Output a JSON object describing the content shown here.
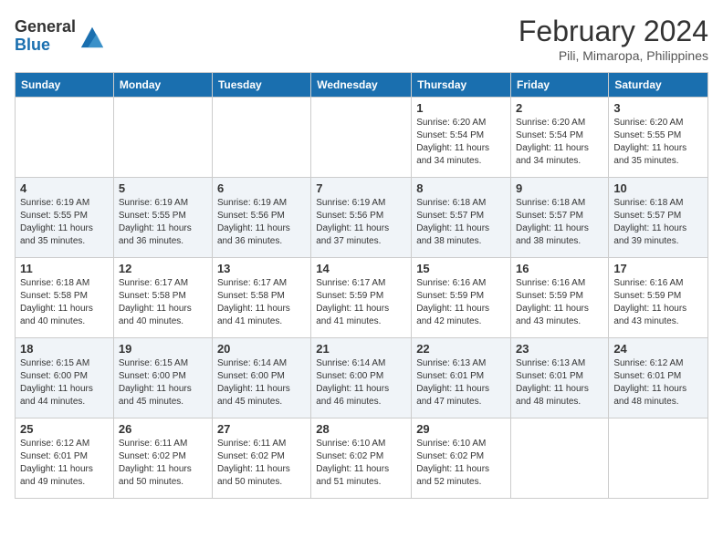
{
  "logo": {
    "general": "General",
    "blue": "Blue"
  },
  "title": "February 2024",
  "location": "Pili, Mimaropa, Philippines",
  "days_of_week": [
    "Sunday",
    "Monday",
    "Tuesday",
    "Wednesday",
    "Thursday",
    "Friday",
    "Saturday"
  ],
  "weeks": [
    [
      {
        "day": "",
        "sunrise": "",
        "sunset": "",
        "daylight": ""
      },
      {
        "day": "",
        "sunrise": "",
        "sunset": "",
        "daylight": ""
      },
      {
        "day": "",
        "sunrise": "",
        "sunset": "",
        "daylight": ""
      },
      {
        "day": "",
        "sunrise": "",
        "sunset": "",
        "daylight": ""
      },
      {
        "day": "1",
        "sunrise": "Sunrise: 6:20 AM",
        "sunset": "Sunset: 5:54 PM",
        "daylight": "Daylight: 11 hours and 34 minutes."
      },
      {
        "day": "2",
        "sunrise": "Sunrise: 6:20 AM",
        "sunset": "Sunset: 5:54 PM",
        "daylight": "Daylight: 11 hours and 34 minutes."
      },
      {
        "day": "3",
        "sunrise": "Sunrise: 6:20 AM",
        "sunset": "Sunset: 5:55 PM",
        "daylight": "Daylight: 11 hours and 35 minutes."
      }
    ],
    [
      {
        "day": "4",
        "sunrise": "Sunrise: 6:19 AM",
        "sunset": "Sunset: 5:55 PM",
        "daylight": "Daylight: 11 hours and 35 minutes."
      },
      {
        "day": "5",
        "sunrise": "Sunrise: 6:19 AM",
        "sunset": "Sunset: 5:55 PM",
        "daylight": "Daylight: 11 hours and 36 minutes."
      },
      {
        "day": "6",
        "sunrise": "Sunrise: 6:19 AM",
        "sunset": "Sunset: 5:56 PM",
        "daylight": "Daylight: 11 hours and 36 minutes."
      },
      {
        "day": "7",
        "sunrise": "Sunrise: 6:19 AM",
        "sunset": "Sunset: 5:56 PM",
        "daylight": "Daylight: 11 hours and 37 minutes."
      },
      {
        "day": "8",
        "sunrise": "Sunrise: 6:18 AM",
        "sunset": "Sunset: 5:57 PM",
        "daylight": "Daylight: 11 hours and 38 minutes."
      },
      {
        "day": "9",
        "sunrise": "Sunrise: 6:18 AM",
        "sunset": "Sunset: 5:57 PM",
        "daylight": "Daylight: 11 hours and 38 minutes."
      },
      {
        "day": "10",
        "sunrise": "Sunrise: 6:18 AM",
        "sunset": "Sunset: 5:57 PM",
        "daylight": "Daylight: 11 hours and 39 minutes."
      }
    ],
    [
      {
        "day": "11",
        "sunrise": "Sunrise: 6:18 AM",
        "sunset": "Sunset: 5:58 PM",
        "daylight": "Daylight: 11 hours and 40 minutes."
      },
      {
        "day": "12",
        "sunrise": "Sunrise: 6:17 AM",
        "sunset": "Sunset: 5:58 PM",
        "daylight": "Daylight: 11 hours and 40 minutes."
      },
      {
        "day": "13",
        "sunrise": "Sunrise: 6:17 AM",
        "sunset": "Sunset: 5:58 PM",
        "daylight": "Daylight: 11 hours and 41 minutes."
      },
      {
        "day": "14",
        "sunrise": "Sunrise: 6:17 AM",
        "sunset": "Sunset: 5:59 PM",
        "daylight": "Daylight: 11 hours and 41 minutes."
      },
      {
        "day": "15",
        "sunrise": "Sunrise: 6:16 AM",
        "sunset": "Sunset: 5:59 PM",
        "daylight": "Daylight: 11 hours and 42 minutes."
      },
      {
        "day": "16",
        "sunrise": "Sunrise: 6:16 AM",
        "sunset": "Sunset: 5:59 PM",
        "daylight": "Daylight: 11 hours and 43 minutes."
      },
      {
        "day": "17",
        "sunrise": "Sunrise: 6:16 AM",
        "sunset": "Sunset: 5:59 PM",
        "daylight": "Daylight: 11 hours and 43 minutes."
      }
    ],
    [
      {
        "day": "18",
        "sunrise": "Sunrise: 6:15 AM",
        "sunset": "Sunset: 6:00 PM",
        "daylight": "Daylight: 11 hours and 44 minutes."
      },
      {
        "day": "19",
        "sunrise": "Sunrise: 6:15 AM",
        "sunset": "Sunset: 6:00 PM",
        "daylight": "Daylight: 11 hours and 45 minutes."
      },
      {
        "day": "20",
        "sunrise": "Sunrise: 6:14 AM",
        "sunset": "Sunset: 6:00 PM",
        "daylight": "Daylight: 11 hours and 45 minutes."
      },
      {
        "day": "21",
        "sunrise": "Sunrise: 6:14 AM",
        "sunset": "Sunset: 6:00 PM",
        "daylight": "Daylight: 11 hours and 46 minutes."
      },
      {
        "day": "22",
        "sunrise": "Sunrise: 6:13 AM",
        "sunset": "Sunset: 6:01 PM",
        "daylight": "Daylight: 11 hours and 47 minutes."
      },
      {
        "day": "23",
        "sunrise": "Sunrise: 6:13 AM",
        "sunset": "Sunset: 6:01 PM",
        "daylight": "Daylight: 11 hours and 48 minutes."
      },
      {
        "day": "24",
        "sunrise": "Sunrise: 6:12 AM",
        "sunset": "Sunset: 6:01 PM",
        "daylight": "Daylight: 11 hours and 48 minutes."
      }
    ],
    [
      {
        "day": "25",
        "sunrise": "Sunrise: 6:12 AM",
        "sunset": "Sunset: 6:01 PM",
        "daylight": "Daylight: 11 hours and 49 minutes."
      },
      {
        "day": "26",
        "sunrise": "Sunrise: 6:11 AM",
        "sunset": "Sunset: 6:02 PM",
        "daylight": "Daylight: 11 hours and 50 minutes."
      },
      {
        "day": "27",
        "sunrise": "Sunrise: 6:11 AM",
        "sunset": "Sunset: 6:02 PM",
        "daylight": "Daylight: 11 hours and 50 minutes."
      },
      {
        "day": "28",
        "sunrise": "Sunrise: 6:10 AM",
        "sunset": "Sunset: 6:02 PM",
        "daylight": "Daylight: 11 hours and 51 minutes."
      },
      {
        "day": "29",
        "sunrise": "Sunrise: 6:10 AM",
        "sunset": "Sunset: 6:02 PM",
        "daylight": "Daylight: 11 hours and 52 minutes."
      },
      {
        "day": "",
        "sunrise": "",
        "sunset": "",
        "daylight": ""
      },
      {
        "day": "",
        "sunrise": "",
        "sunset": "",
        "daylight": ""
      }
    ]
  ]
}
